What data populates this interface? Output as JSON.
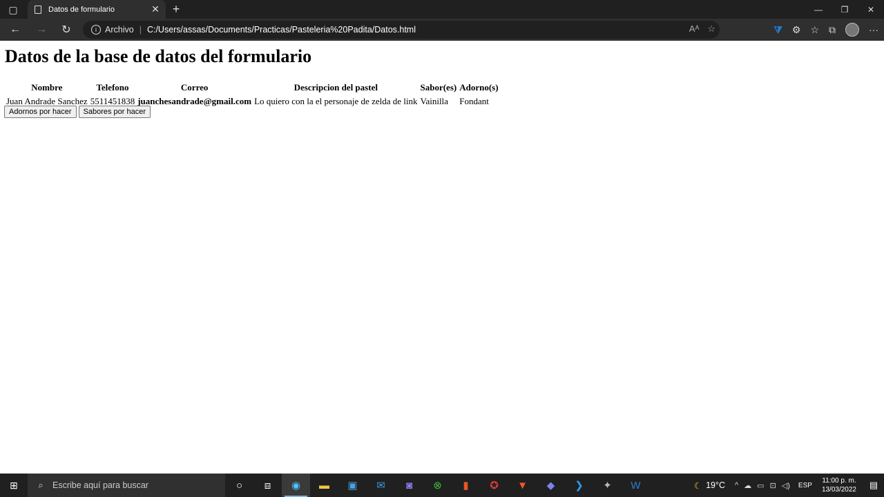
{
  "browser": {
    "tab_title": "Datos de formulario",
    "address_scheme_label": "Archivo",
    "address_url": "C:/Users/assas/Documents/Practicas/Pasteleria%20Padita/Datos.html"
  },
  "page": {
    "heading": "Datos de la base de datos del formulario",
    "table": {
      "headers": [
        "Nombre",
        "Telefono",
        "Correo",
        "Descripcion del pastel",
        "Sabor(es)",
        "Adorno(s)"
      ],
      "rows": [
        [
          "Juan Andrade Sanchez",
          "5511451838",
          "juanchesandrade@gmail.com",
          "Lo quiero con la el personaje de zelda de link",
          "Vainilla",
          "Fondant"
        ]
      ]
    },
    "buttons": {
      "adornos": "Adornos por hacer",
      "sabores": "Sabores por hacer"
    }
  },
  "taskbar": {
    "search_placeholder": "Escribe aquí para buscar",
    "temperature": "19°C",
    "language": "ESP",
    "time": "11:00 p. m.",
    "date": "13/03/2022"
  },
  "colors": {
    "taskbar_bg": "#202020",
    "toolbar_bg": "#2f2f2f",
    "accent": "#76b9ed"
  }
}
